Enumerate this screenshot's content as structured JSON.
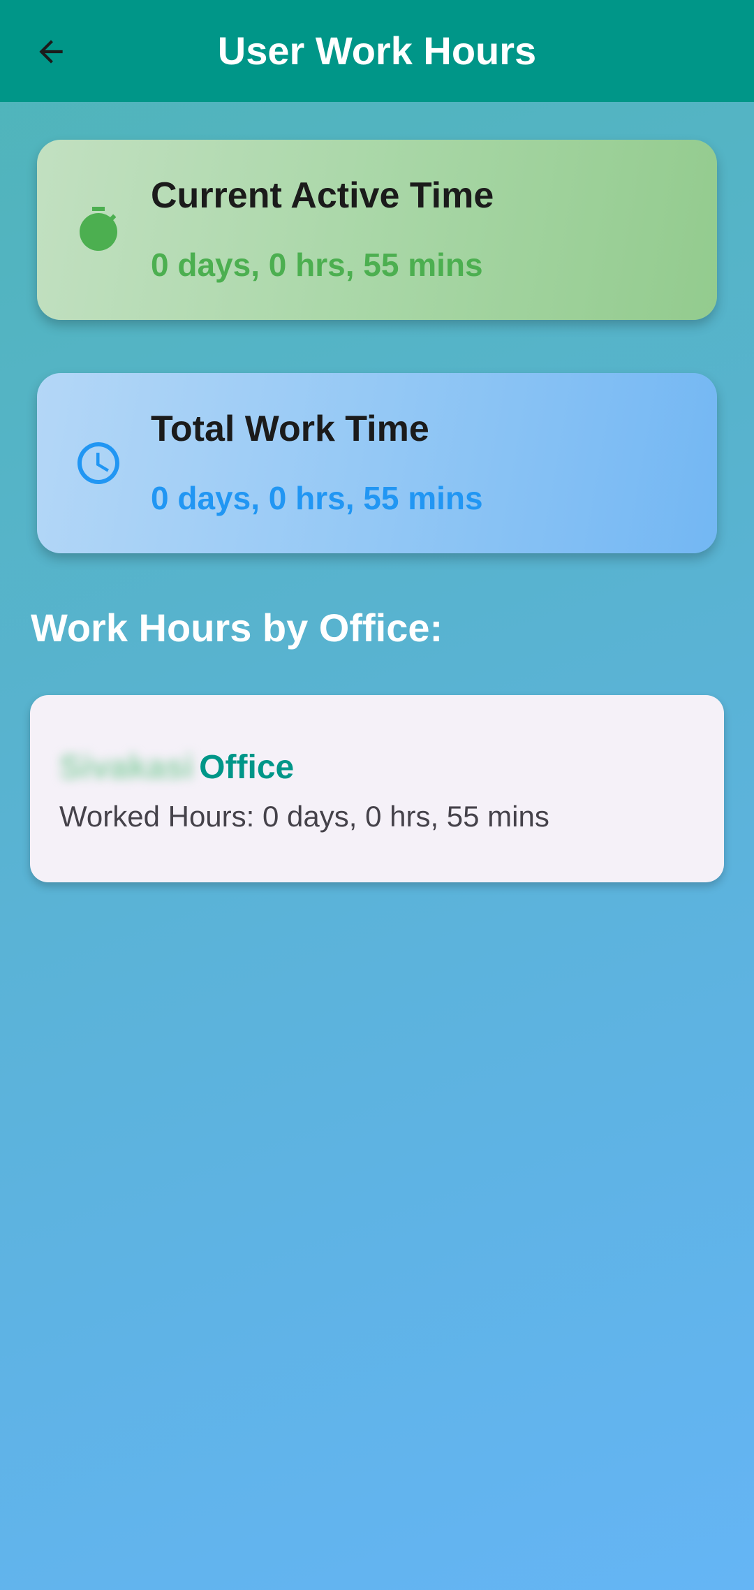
{
  "app_bar": {
    "title": "User Work Hours",
    "back_icon": "arrow-left-icon",
    "background_color": "#009688"
  },
  "current_active": {
    "icon": "stopwatch-icon",
    "title": "Current Active Time",
    "value": "0 days, 0 hrs, 55 mins",
    "accent_color": "#4caf50"
  },
  "total_work": {
    "icon": "clock-icon",
    "title": "Total Work Time",
    "value": "0 days, 0 hrs, 55 mins",
    "accent_color": "#2196f3"
  },
  "offices_section": {
    "heading": "Work Hours by Office:",
    "offices": [
      {
        "name": "Sivakasi",
        "suffix": "Office",
        "worked_hours": "Worked Hours: 0 days, 0 hrs, 55 mins",
        "name_blurred": true
      }
    ]
  }
}
